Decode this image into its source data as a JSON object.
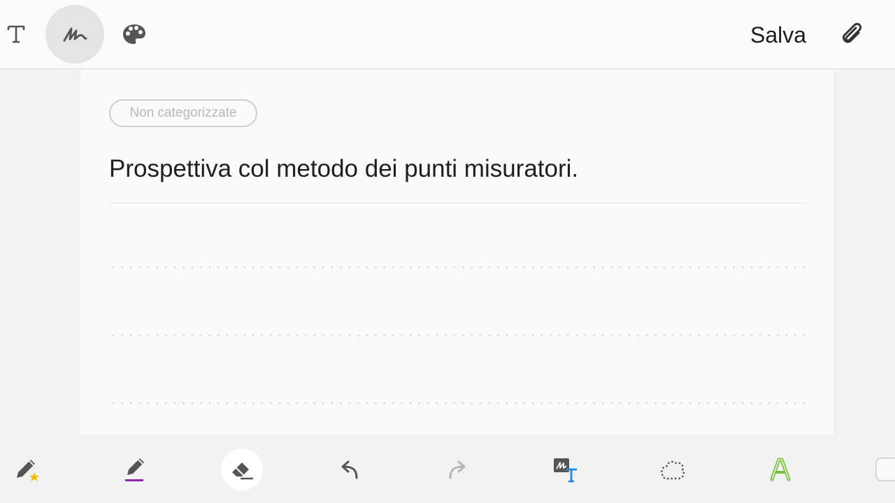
{
  "toolbar": {
    "save_label": "Salva",
    "icons": [
      "text-mode-icon",
      "handwriting-icon",
      "palette-icon",
      "paperclip-icon"
    ],
    "active_mode": "handwriting"
  },
  "note": {
    "category": "Non categorizzate",
    "title": "Prospettiva col metodo dei punti misuratori."
  },
  "drawing_tools": {
    "items": [
      "favorite-pen-icon",
      "pen-icon",
      "eraser-icon",
      "undo-icon",
      "redo-icon",
      "handwriting-to-text-icon",
      "lasso-select-icon",
      "shape-text-icon"
    ],
    "selected": "eraser",
    "pen_color": "#8e24aa",
    "favorite_star_color": "#f5b800",
    "convert_text_color": "#1e88e5",
    "shape_text_color": "#7bc043"
  }
}
